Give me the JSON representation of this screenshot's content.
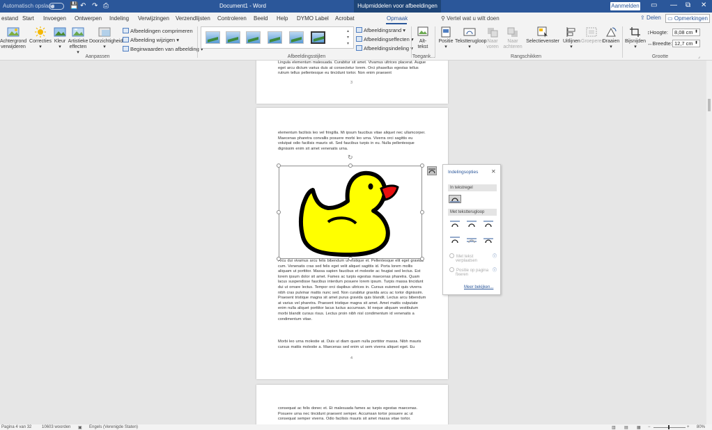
{
  "titlebar": {
    "autosave": "Automatisch opslaan",
    "doc_title": "Document1 - Word",
    "context_tab": "Hulpmiddelen voor afbeeldingen",
    "signin": "Aanmelden",
    "minimize": "—",
    "restore": "⧉",
    "close": "✕",
    "save_icon": "💾",
    "undo_icon": "↶",
    "redo_icon": "↷",
    "qat_icon": "⎙"
  },
  "tabs": [
    "estand",
    "Start",
    "Invoegen",
    "Ontwerpen",
    "Indeling",
    "Verwijzingen",
    "Verzendlijsten",
    "Controleren",
    "Beeld",
    "Help",
    "DYMO Label",
    "Acrobat",
    "Opmaak"
  ],
  "tellme": "Vertel wat u wilt doen",
  "share": "Delen",
  "comments": "Opmerkingen",
  "ribbon": {
    "remove_bg": [
      "Achtergrond",
      "verwijderen"
    ],
    "corrections": "Correcties",
    "color": "Kleur",
    "artistic": [
      "Artistieke",
      "effecten"
    ],
    "transparency": "Doorzichtigheid",
    "compress": "Afbeeldingen comprimeren",
    "change": "Afbeelding wijzigen",
    "reset": "Beginwaarden van afbeelding",
    "adjust_label": "Aanpassen",
    "border": "Afbeeldingsrand",
    "effects": "Afbeeldingseffecten",
    "layout": "Afbeeldingsindeling",
    "styles_label": "Afbeeldingsstijlen",
    "alt": [
      "Alt-",
      "tekst"
    ],
    "access_label": "Toegank...",
    "position": "Positie",
    "wraptext": "Tekstterugloop",
    "forward": [
      "Naar",
      "voren"
    ],
    "backward": [
      "Naar",
      "achteren"
    ],
    "selpane": "Selectievenster",
    "align": "Uitlijnen",
    "group": "Groeperen",
    "rotate": "Draaien",
    "arrange_label": "Rangschikken",
    "crop": "Bijsnijden",
    "height_label": "Hoogte:",
    "height_val": "8,08 cm",
    "width_label": "Breedte:",
    "width_val": "12,7 cm",
    "size_label": "Grootte"
  },
  "page3": {
    "text": "Lingula elementum malesuada. Curabitur sit amet. Vivamus ultrices placerat. Augue eget arcu dictum varius duis at consectetur lorem. Orci phasellus egestas tellus rutrum tellus pellentesque eu tincidunt tortor. Non enim praesent",
    "num": "3"
  },
  "page4": {
    "p1": "elementum facilisis leo vel fringilla. Mi ipsum faucibus vitae aliquet nec ullamcorper. Maecenas pharetra convallis posuere morbi leo urna. Viverra orci sagittis eu volutpat odio facilisis mauris sit. Sed faucibus turpis in eu. Nulla pellentesque dignissim enim sit amet venenatis urna.",
    "p2": "Arcu dui vivamus arcu felis bibendum ut tristique et. Pellentesque elit eget gravida cum. Venenatis cras sed felis eget velit aliquet sagittis id. Porta lorem mollis aliquam ut porttitor. Massa sapien faucibus et molestie ac feugiat sed lectus. Est lorem ipsum dolor sit amet. Fames ac turpis egestas maecenas pharetra. Quam lacus suspendisse faucibus interdum posuere lorem ipsum. Turpis massa tincidunt dui ut ornare lectus. Tempor orci dapibus ultrices in. Cursus euismod quis viverra nibh cras pulvinar mattis nunc sed. Non curabitur gravida arcu ac tortor dignissim. Praesent tristique magna sit amet purus gravida quis blandit. Lectus arcu bibendum at varius vel pharetra. Praesent tristique magna sit amet. Amet mattis vulputate enim nulla aliquet porttitor lacus luctus accumsan. Id neque aliquam vestibulum morbi blandit cursus risus. Lectus proin nibh nisl condimentum id venenatis a condimentum vitae.",
    "p3": "Morbi leo urna molestie at. Duis ut diam quam nulla porttitor massa. Nibh mauris cursus mattis molestie a. Maecenas sed enim ut sem viverra aliquet eget. Eu",
    "num": "4"
  },
  "page5": {
    "text": "consequat ac felis donec et. Et malesuada fames ac turpis egestas maecenas. Posuere urna nec tincidunt praesent semper. Accumsan tortor posuere ac ut consequat semper viverra. Odio facilisis mauris sit amet massa vitae tortor."
  },
  "flyout": {
    "title": "Indelingsopties",
    "close": "✕",
    "inline_section": "In tekstregel",
    "wrap_section": "Met tekstterugloop",
    "radio1": [
      "Met tekst",
      "verplaatsen"
    ],
    "radio2": [
      "Positie op pagina",
      "fixeren"
    ],
    "more": "Meer bekijken..."
  },
  "status": {
    "page": "Pagina 4 van 32",
    "words": "10603 woorden",
    "lang": "Engels (Verenigde Staten)",
    "zoom": "80%"
  },
  "colors": {
    "accent": "#2b579a",
    "duck_body": "#ffff00",
    "duck_beak": "#e81010"
  }
}
